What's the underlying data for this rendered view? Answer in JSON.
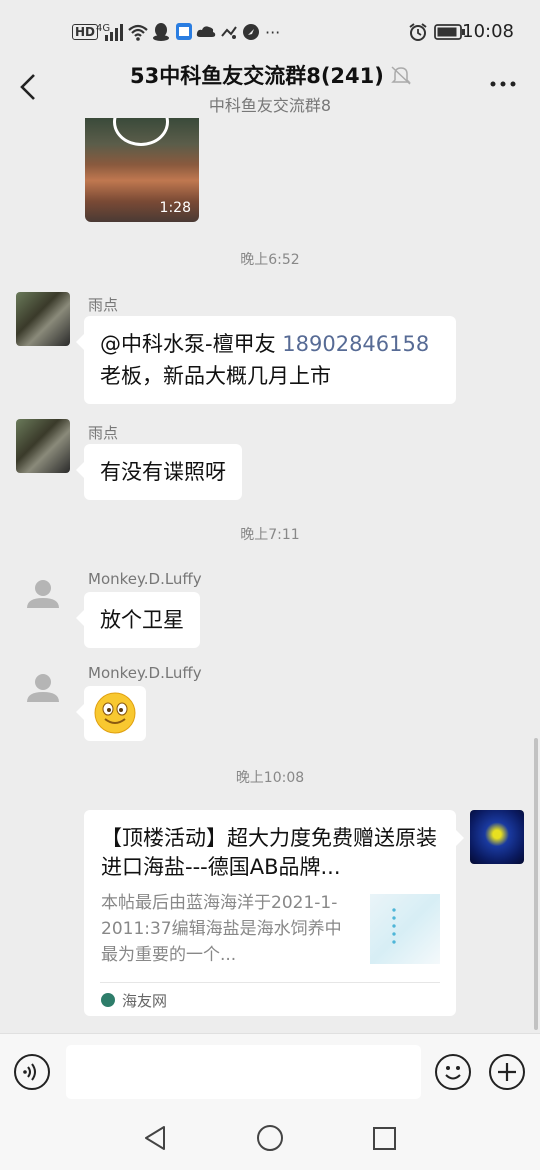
{
  "status_bar": {
    "time": "10:08",
    "left_icons": [
      "HD",
      "4G",
      "signal-icon",
      "wifi-icon",
      "qq-icon",
      "app-icon",
      "cloud-icon",
      "weather-icon",
      "browser-icon",
      "more-dots"
    ],
    "hd_label": "HD",
    "net_label": "4G",
    "dots": "···"
  },
  "header": {
    "title": "53中科鱼友交流群8(241)",
    "subtitle": "中科鱼友交流群8"
  },
  "messages": {
    "video_duration": "1:28",
    "ts1": "晚上6:52",
    "msg1": {
      "sender": "雨点",
      "mention": "@中科水泵-檀甲友",
      "number": "18902846158",
      "line2": "老板，新品大概几月上市"
    },
    "msg2": {
      "sender": "雨点",
      "text": "有没有谍照呀"
    },
    "ts2": "晚上7:11",
    "msg3": {
      "sender": "Monkey.D.Luffy",
      "text": "放个卫星"
    },
    "msg4": {
      "sender": "Monkey.D.Luffy"
    },
    "ts3": "晚上10:08",
    "card": {
      "title": "【顶楼活动】超大力度免费赠送原装进口海盐---德国AB品牌...",
      "desc": "本帖最后由蓝海海洋于2021-1-2011:37编辑海盐是海水饲养中最为重要的一个...",
      "source": "海友网"
    }
  },
  "colors": {
    "background": "#ededed",
    "bubble": "#ffffff",
    "link": "#576b95"
  }
}
